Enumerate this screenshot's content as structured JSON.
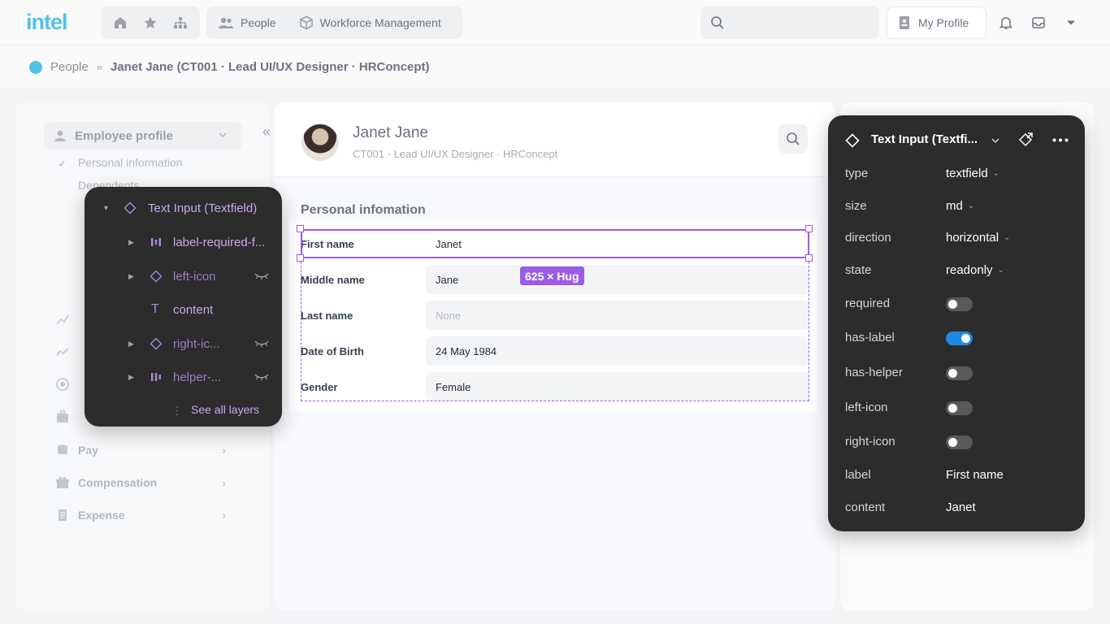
{
  "topbar": {
    "logo": "intel",
    "nav_tabs": [
      {
        "label": "People",
        "icon": "people-icon"
      },
      {
        "label": "Workforce Management",
        "icon": "cube-icon"
      }
    ],
    "search_placeholder": "",
    "profile_label": "My Profile"
  },
  "breadcrumb": {
    "root": "People",
    "current": "Janet Jane (CT001 · Lead UI/UX Designer · HRConcept)"
  },
  "sidebar": {
    "section_title": "Employee profile",
    "sub_items": [
      "Personal information",
      "Dependents"
    ],
    "items": [
      {
        "label": "Pay",
        "icon": "coins-icon"
      },
      {
        "label": "Compensation",
        "icon": "gift-icon"
      },
      {
        "label": "Expense",
        "icon": "receipt-icon"
      }
    ]
  },
  "employee": {
    "name": "Janet Jane",
    "subtitle": "CT001 · Lead UI/UX Designer · HRConcept"
  },
  "personal": {
    "section_title": "Personal infomation",
    "fields": [
      {
        "label": "First name",
        "value": "Janet",
        "placeholder": false
      },
      {
        "label": "Middle name",
        "value": "Jane",
        "placeholder": false
      },
      {
        "label": "Last name",
        "value": "None",
        "placeholder": true
      },
      {
        "label": "Date of Birth",
        "value": "24 May 1984",
        "placeholder": false
      },
      {
        "label": "Gender",
        "value": "Female",
        "placeholder": false
      }
    ],
    "size_tag": "625 × Hug"
  },
  "layers": {
    "items": [
      {
        "label": "Text Input (Textfield)",
        "icon": "component-icon",
        "expanded": true
      },
      {
        "label": "label-required-f...",
        "icon": "frame-icon"
      },
      {
        "label": "left-icon",
        "icon": "component-icon",
        "hidden": true
      },
      {
        "label": "content",
        "icon": "text-icon"
      },
      {
        "label": "right-ic...",
        "icon": "component-icon",
        "hidden": true
      },
      {
        "label": "helper-...",
        "icon": "frame-icon",
        "hidden": true
      }
    ],
    "see_all": "See all layers"
  },
  "props": {
    "title": "Text Input (Textfi...",
    "rows": [
      {
        "key": "type",
        "value": "textfield",
        "kind": "select"
      },
      {
        "key": "size",
        "value": "md",
        "kind": "select"
      },
      {
        "key": "direction",
        "value": "horizontal",
        "kind": "select"
      },
      {
        "key": "state",
        "value": "readonly",
        "kind": "select"
      },
      {
        "key": "required",
        "value": false,
        "kind": "toggle"
      },
      {
        "key": "has-label",
        "value": true,
        "kind": "toggle"
      },
      {
        "key": "has-helper",
        "value": false,
        "kind": "toggle"
      },
      {
        "key": "left-icon",
        "value": false,
        "kind": "toggle"
      },
      {
        "key": "right-icon",
        "value": false,
        "kind": "toggle"
      },
      {
        "key": "label",
        "value": "First name",
        "kind": "text"
      },
      {
        "key": "content",
        "value": "Janet",
        "kind": "text"
      }
    ]
  },
  "colors": {
    "accent": "#9b5de5",
    "brand": "#4fc3e8",
    "toggle_on": "#1e88e5",
    "panel_bg": "#2c2c2c"
  }
}
